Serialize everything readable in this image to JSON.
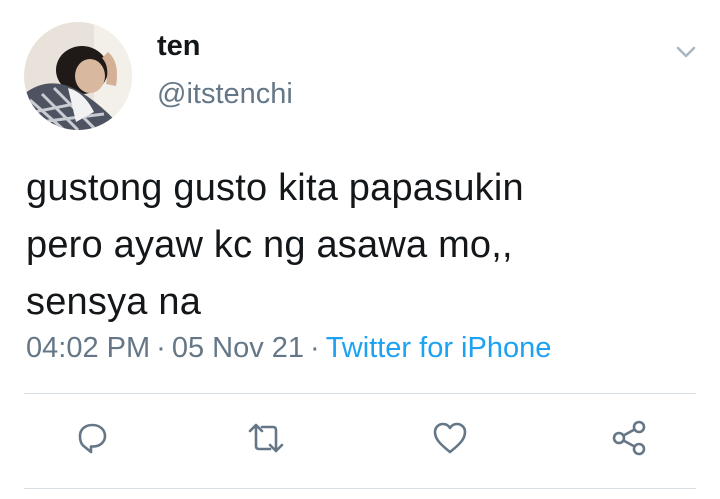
{
  "tweet": {
    "display_name": "ten",
    "handle": "@itstenchi",
    "text": "gustong gusto kita papasukin\npero ayaw kc ng asawa mo,,\nsensya na",
    "time": "04:02 PM",
    "separator": "·",
    "date": "05 Nov 21",
    "source": "Twitter for iPhone"
  },
  "icons": {
    "caret": "chevron-down-icon",
    "reply": "reply-icon",
    "retweet": "retweet-icon",
    "like": "heart-icon",
    "share": "share-icon"
  },
  "colors": {
    "text": "#14171a",
    "secondary": "#657786",
    "link": "#1da1f2",
    "divider": "#d8e0e6"
  }
}
